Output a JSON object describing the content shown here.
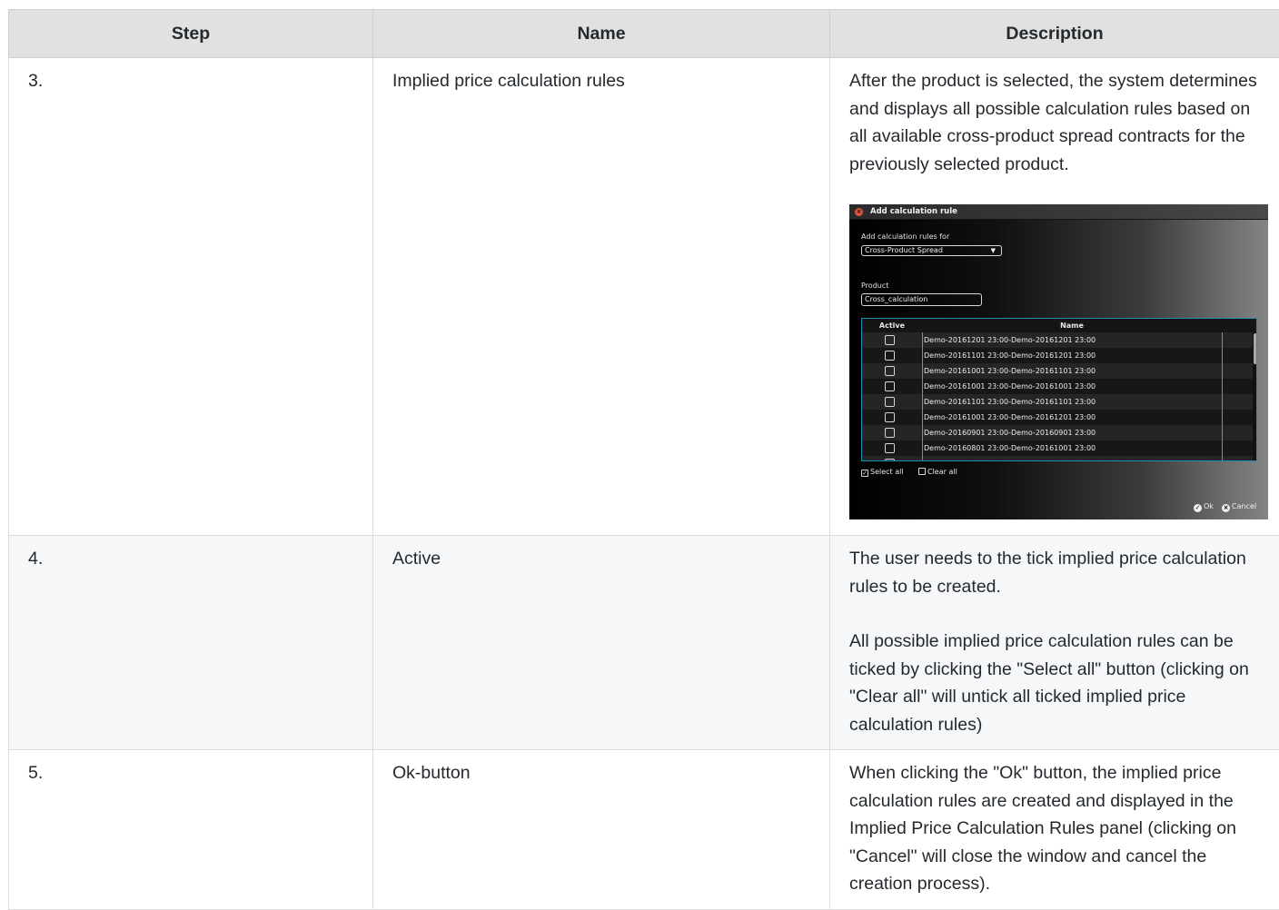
{
  "table": {
    "headers": {
      "step": "Step",
      "name": "Name",
      "description": "Description"
    },
    "rows": [
      {
        "step": "3.",
        "name": "Implied price calculation rules",
        "description": [
          "After the product is selected, the system determines and displays all possible calculation rules based on all available cross-product spread contracts for the previously selected product."
        ]
      },
      {
        "step": "4.",
        "name": "Active",
        "description": [
          "The user needs to the tick implied price calculation rules to be created.",
          "All possible implied price calculation rules can be ticked by clicking the \"Select all\" button (clicking on \"Clear all\" will untick all ticked implied price calculation rules)"
        ]
      },
      {
        "step": "5.",
        "name": "Ok-button",
        "description": [
          "When clicking the \"Ok\" button, the implied price calculation rules are created and displayed in the Implied Price Calculation Rules panel (clicking on \"Cancel\" will close the window and cancel the creation process)."
        ]
      }
    ]
  },
  "dialog": {
    "title": "Add calculation rule",
    "close_icon": "close-icon",
    "rules_for_label": "Add calculation rules for",
    "rules_for_value": "Cross-Product Spread",
    "product_label": "Product",
    "product_value": "Cross_calculation",
    "grid_headers": {
      "active": "Active",
      "name": "Name"
    },
    "grid_rows": [
      "Demo-20161201 23:00-Demo-20161201 23:00",
      "Demo-20161101 23:00-Demo-20161201 23:00",
      "Demo-20161001 23:00-Demo-20161101 23:00",
      "Demo-20161001 23:00-Demo-20161001 23:00",
      "Demo-20161101 23:00-Demo-20161101 23:00",
      "Demo-20161001 23:00-Demo-20161201 23:00",
      "Demo-20160901 23:00-Demo-20160901 23:00",
      "Demo-20160801 23:00-Demo-20161001 23:00"
    ],
    "select_all": "Select all",
    "clear_all": "Clear all",
    "ok": "Ok",
    "cancel": "Cancel",
    "colors": {
      "accent": "#1f8fb8",
      "close": "#e0533a"
    }
  }
}
